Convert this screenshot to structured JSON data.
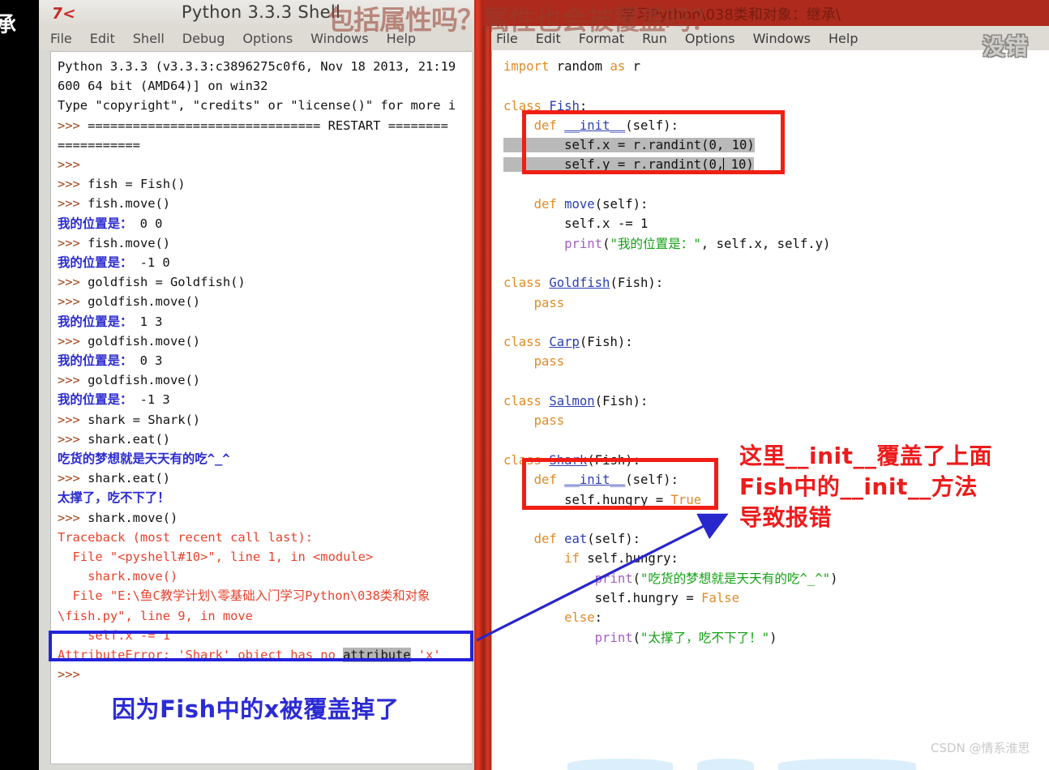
{
  "overlay": {
    "left_edge_glyph": "承",
    "title_overlay_text": "包括属性吗？属性也会被覆盖吗？",
    "ok_note": "没错",
    "watermark": "CSDN @情系淮思"
  },
  "shell_window": {
    "title": "Python 3.3.3 Shell",
    "logo": "7<",
    "menu": [
      "File",
      "Edit",
      "Shell",
      "Debug",
      "Options",
      "Windows",
      "Help"
    ],
    "lines": [
      [
        {
          "t": "Python 3.3.3 (v3.3.3:c3896275c0f6, Nov 18 2013, 21:19",
          "c": "plain"
        }
      ],
      [
        {
          "t": "600 64 bit (AMD64)] on win32",
          "c": "plain"
        }
      ],
      [
        {
          "t": "Type \"copyright\", \"credits\" or \"license()\" for more i",
          "c": "plain"
        }
      ],
      [
        {
          "t": ">>> ",
          "c": "prompt"
        },
        {
          "t": "=============================== RESTART ========",
          "c": "plain"
        }
      ],
      [
        {
          "t": "===========",
          "c": "plain"
        }
      ],
      [
        {
          "t": ">>> ",
          "c": "prompt"
        }
      ],
      [
        {
          "t": ">>> ",
          "c": "prompt"
        },
        {
          "t": "fish = Fish()",
          "c": "plain"
        }
      ],
      [
        {
          "t": ">>> ",
          "c": "prompt"
        },
        {
          "t": "fish.move()",
          "c": "plain"
        }
      ],
      [
        {
          "t": "我的位置是：",
          "c": "out"
        },
        {
          "t": " 0 0",
          "c": "plain"
        }
      ],
      [
        {
          "t": ">>> ",
          "c": "prompt"
        },
        {
          "t": "fish.move()",
          "c": "plain"
        }
      ],
      [
        {
          "t": "我的位置是：",
          "c": "out"
        },
        {
          "t": " -1 0",
          "c": "plain"
        }
      ],
      [
        {
          "t": ">>> ",
          "c": "prompt"
        },
        {
          "t": "goldfish = Goldfish()",
          "c": "plain"
        }
      ],
      [
        {
          "t": ">>> ",
          "c": "prompt"
        },
        {
          "t": "goldfish.move()",
          "c": "plain"
        }
      ],
      [
        {
          "t": "我的位置是：",
          "c": "out"
        },
        {
          "t": " 1 3",
          "c": "plain"
        }
      ],
      [
        {
          "t": ">>> ",
          "c": "prompt"
        },
        {
          "t": "goldfish.move()",
          "c": "plain"
        }
      ],
      [
        {
          "t": "我的位置是：",
          "c": "out"
        },
        {
          "t": " 0 3",
          "c": "plain"
        }
      ],
      [
        {
          "t": ">>> ",
          "c": "prompt"
        },
        {
          "t": "goldfish.move()",
          "c": "plain"
        }
      ],
      [
        {
          "t": "我的位置是：",
          "c": "out"
        },
        {
          "t": " -1 3",
          "c": "plain"
        }
      ],
      [
        {
          "t": ">>> ",
          "c": "prompt"
        },
        {
          "t": "shark = Shark()",
          "c": "plain"
        }
      ],
      [
        {
          "t": ">>> ",
          "c": "prompt"
        },
        {
          "t": "shark.eat()",
          "c": "plain"
        }
      ],
      [
        {
          "t": "吃货的梦想就是天天有的吃^_^",
          "c": "out"
        }
      ],
      [
        {
          "t": ">>> ",
          "c": "prompt"
        },
        {
          "t": "shark.eat()",
          "c": "plain"
        }
      ],
      [
        {
          "t": "太撑了，吃不下了！",
          "c": "out"
        }
      ],
      [
        {
          "t": ">>> ",
          "c": "prompt"
        },
        {
          "t": "shark.move()",
          "c": "plain"
        }
      ],
      [
        {
          "t": "Traceback (most recent call last):",
          "c": "err"
        }
      ],
      [
        {
          "t": "  File \"<pyshell#10>\", line 1, in <module>",
          "c": "err"
        }
      ],
      [
        {
          "t": "    shark.move()",
          "c": "err"
        }
      ],
      [
        {
          "t": "  File \"E:\\鱼C教学计划\\零基础入门学习Python\\038类和对象",
          "c": "err"
        }
      ],
      [
        {
          "t": "\\fish.py\", line 9, in move",
          "c": "err"
        }
      ],
      [
        {
          "t": "    self.x -= 1",
          "c": "err"
        }
      ],
      [
        {
          "t": "AttributeError: 'Shark' object has no ",
          "c": "err"
        },
        {
          "t": "attribute",
          "c": "sel"
        },
        {
          "t": " 'x'",
          "c": "err"
        }
      ],
      [
        {
          "t": ">>>",
          "c": "prompt"
        }
      ]
    ],
    "bottom_annotation": "因为Fish中的x被覆盖掉了"
  },
  "editor_window": {
    "title": "学习Python\\038类和对象：继承\\",
    "menu": [
      "File",
      "Edit",
      "Format",
      "Run",
      "Options",
      "Windows",
      "Help"
    ],
    "code_lines": [
      [
        {
          "t": "import",
          "c": "k"
        },
        {
          "t": " random ",
          "c": "p"
        },
        {
          "t": "as",
          "c": "k"
        },
        {
          "t": " r",
          "c": "p"
        }
      ],
      [],
      [
        {
          "t": "class",
          "c": "k"
        },
        {
          "t": " ",
          "c": "p"
        },
        {
          "t": "Fish",
          "c": "dun"
        },
        {
          "t": ":",
          "c": "p"
        }
      ],
      [
        {
          "t": "    ",
          "c": "p"
        },
        {
          "t": "def",
          "c": "k"
        },
        {
          "t": " ",
          "c": "p"
        },
        {
          "t": "__init__",
          "c": "dun"
        },
        {
          "t": "(self):",
          "c": "p"
        }
      ],
      [
        {
          "t": "        self.x = r.randint(0, 10)",
          "c": "p",
          "sel": true
        }
      ],
      [
        {
          "t": "        self.y = r.randint(0,",
          "c": "p",
          "sel": true,
          "caret": true
        },
        {
          "t": " 10)",
          "c": "p",
          "sel": true
        }
      ],
      [],
      [
        {
          "t": "    ",
          "c": "p"
        },
        {
          "t": "def",
          "c": "k"
        },
        {
          "t": " ",
          "c": "p"
        },
        {
          "t": "move",
          "c": "cls"
        },
        {
          "t": "(self):",
          "c": "p"
        }
      ],
      [
        {
          "t": "        self.x -= 1",
          "c": "p"
        }
      ],
      [
        {
          "t": "        ",
          "c": "p"
        },
        {
          "t": "print",
          "c": "bi"
        },
        {
          "t": "(",
          "c": "p"
        },
        {
          "t": "\"我的位置是：\"",
          "c": "str"
        },
        {
          "t": ", self.x, self.y)",
          "c": "p"
        }
      ],
      [],
      [
        {
          "t": "class",
          "c": "k"
        },
        {
          "t": " ",
          "c": "p"
        },
        {
          "t": "Goldfish",
          "c": "dun"
        },
        {
          "t": "(Fish):",
          "c": "p"
        }
      ],
      [
        {
          "t": "    ",
          "c": "p"
        },
        {
          "t": "pass",
          "c": "k"
        }
      ],
      [],
      [
        {
          "t": "class",
          "c": "k"
        },
        {
          "t": " ",
          "c": "p"
        },
        {
          "t": "Carp",
          "c": "dun"
        },
        {
          "t": "(Fish):",
          "c": "p"
        }
      ],
      [
        {
          "t": "    ",
          "c": "p"
        },
        {
          "t": "pass",
          "c": "k"
        }
      ],
      [],
      [
        {
          "t": "class",
          "c": "k"
        },
        {
          "t": " ",
          "c": "p"
        },
        {
          "t": "Salmon",
          "c": "dun"
        },
        {
          "t": "(Fish):",
          "c": "p"
        }
      ],
      [
        {
          "t": "    ",
          "c": "p"
        },
        {
          "t": "pass",
          "c": "k"
        }
      ],
      [],
      [
        {
          "t": "class",
          "c": "k"
        },
        {
          "t": " ",
          "c": "p"
        },
        {
          "t": "Shark",
          "c": "dun"
        },
        {
          "t": "(Fish):",
          "c": "p"
        }
      ],
      [
        {
          "t": "    ",
          "c": "p"
        },
        {
          "t": "def",
          "c": "k"
        },
        {
          "t": " ",
          "c": "p"
        },
        {
          "t": "__init__",
          "c": "dun"
        },
        {
          "t": "(self):",
          "c": "p"
        }
      ],
      [
        {
          "t": "        self.hungry = ",
          "c": "p"
        },
        {
          "t": "True",
          "c": "k"
        }
      ],
      [],
      [
        {
          "t": "    ",
          "c": "p"
        },
        {
          "t": "def",
          "c": "k"
        },
        {
          "t": " ",
          "c": "p"
        },
        {
          "t": "eat",
          "c": "cls"
        },
        {
          "t": "(self):",
          "c": "p"
        }
      ],
      [
        {
          "t": "        ",
          "c": "p"
        },
        {
          "t": "if",
          "c": "k"
        },
        {
          "t": " self.hungry:",
          "c": "p"
        }
      ],
      [
        {
          "t": "            ",
          "c": "p"
        },
        {
          "t": "print",
          "c": "bi"
        },
        {
          "t": "(",
          "c": "p"
        },
        {
          "t": "\"吃货的梦想就是天天有的吃^_^\"",
          "c": "str"
        },
        {
          "t": ")",
          "c": "p"
        }
      ],
      [
        {
          "t": "            self.hungry = ",
          "c": "p"
        },
        {
          "t": "False",
          "c": "k"
        }
      ],
      [
        {
          "t": "        ",
          "c": "p"
        },
        {
          "t": "else",
          "c": "k"
        },
        {
          "t": ":",
          "c": "p"
        }
      ],
      [
        {
          "t": "            ",
          "c": "p"
        },
        {
          "t": "print",
          "c": "bi"
        },
        {
          "t": "(",
          "c": "p"
        },
        {
          "t": "\"太撑了，吃不下了！\"",
          "c": "str"
        },
        {
          "t": ")",
          "c": "p"
        }
      ]
    ],
    "red_annotation": [
      "这里__init__覆盖了上面",
      "Fish中的__init__方法",
      "导致报错"
    ]
  },
  "colors": {
    "red_box": "#f01e14",
    "blue_box": "#2222dd",
    "red_text": "#ee1b1b",
    "blue_text": "#2b2bd4",
    "titlebar_red": "#ad2a1c"
  }
}
